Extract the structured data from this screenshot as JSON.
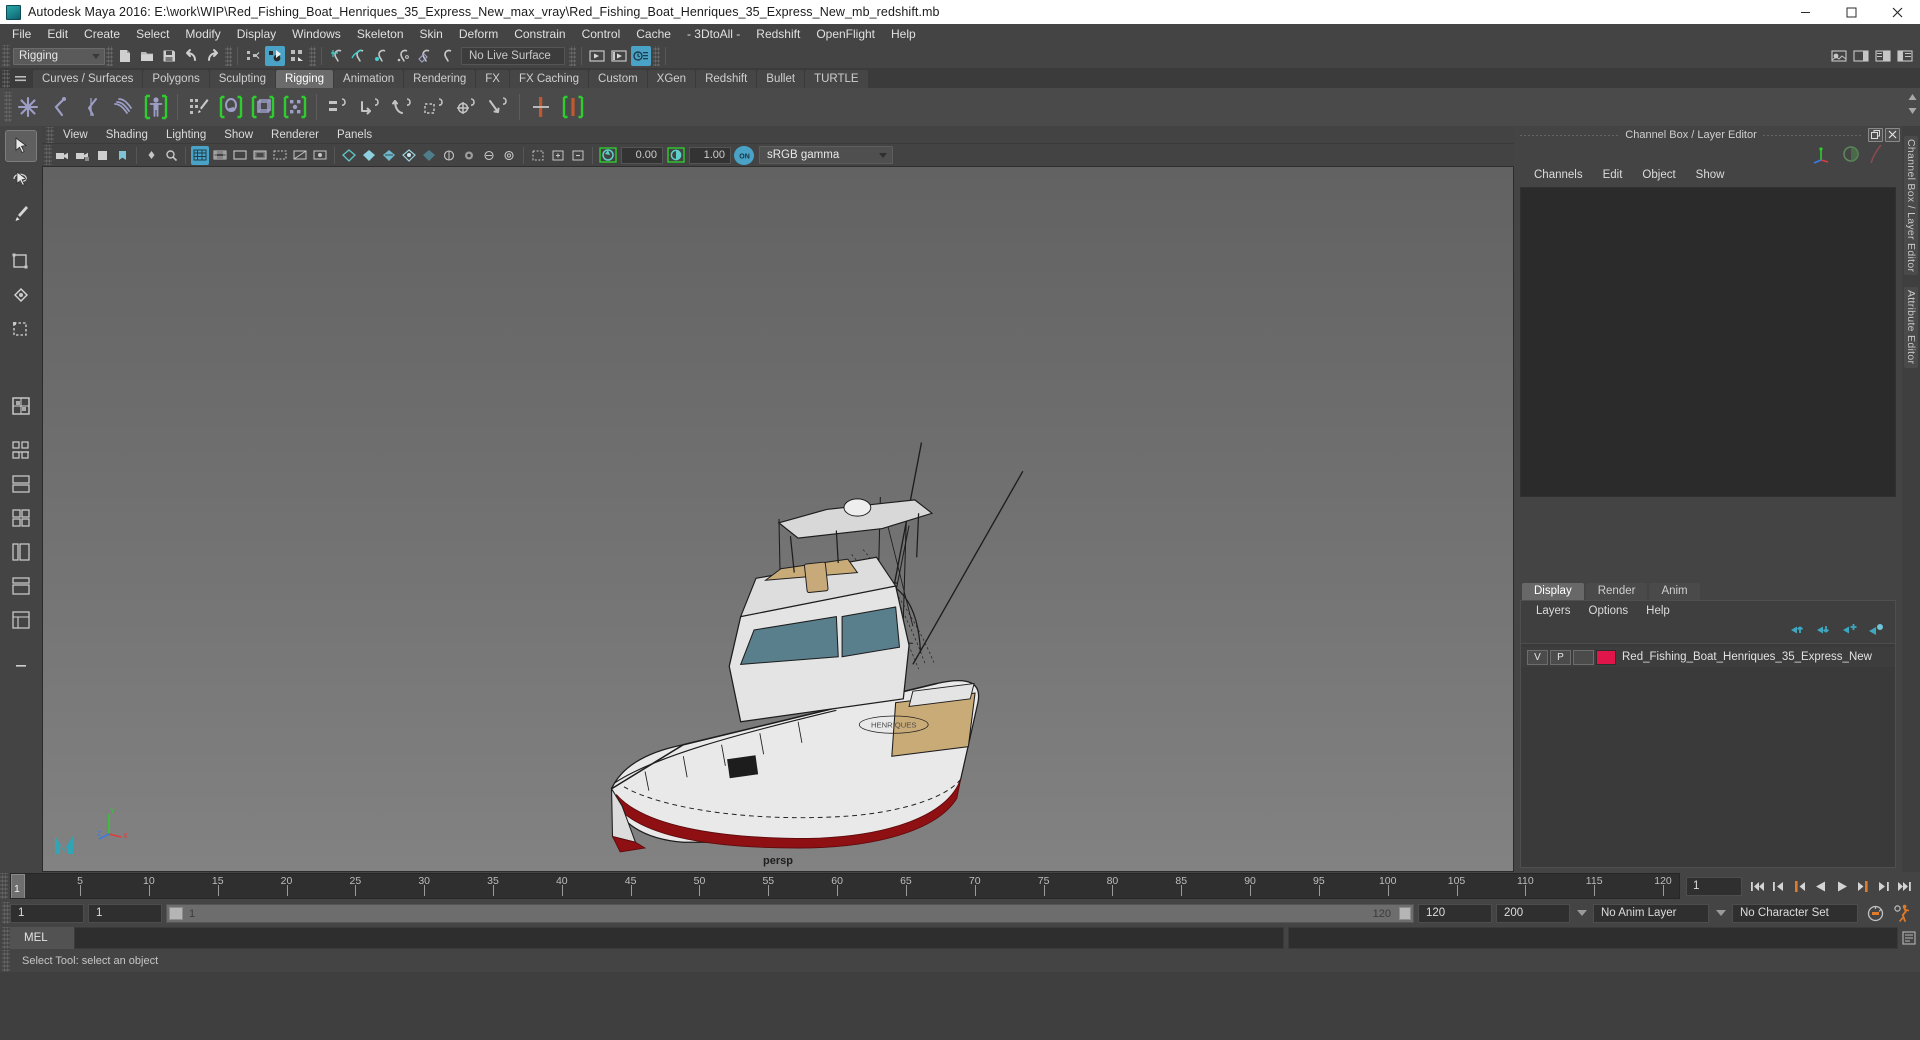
{
  "window": {
    "title": "Autodesk Maya 2016: E:\\work\\WIP\\Red_Fishing_Boat_Henriques_35_Express_New_max_vray\\Red_Fishing_Boat_Henriques_35_Express_New_mb_redshift.mb",
    "icon": "maya-app-icon",
    "minimize": "–",
    "maximize": "□",
    "close": "✕"
  },
  "menubar": {
    "items": [
      {
        "label": "File"
      },
      {
        "label": "Edit"
      },
      {
        "label": "Create"
      },
      {
        "label": "Select"
      },
      {
        "label": "Modify"
      },
      {
        "label": "Display"
      },
      {
        "label": "Windows"
      },
      {
        "label": "Skeleton"
      },
      {
        "label": "Skin"
      },
      {
        "label": "Deform"
      },
      {
        "label": "Constrain"
      },
      {
        "label": "Control"
      },
      {
        "label": "Cache"
      },
      {
        "label": "- 3DtoAll -"
      },
      {
        "label": "Redshift"
      },
      {
        "label": "OpenFlight"
      },
      {
        "label": "Help"
      }
    ]
  },
  "toolbar": {
    "menuset": "Rigging",
    "live_surface": "No Live Surface",
    "icons": [
      {
        "name": "new-scene-icon"
      },
      {
        "name": "open-scene-icon"
      },
      {
        "name": "save-scene-icon"
      },
      {
        "name": "undo-icon"
      },
      {
        "name": "redo-icon"
      },
      {
        "name": "select-hierarchy-icon"
      },
      {
        "name": "select-object-icon"
      },
      {
        "name": "select-component-icon"
      },
      {
        "name": "snap-grid-icon"
      },
      {
        "name": "snap-curve-icon"
      },
      {
        "name": "snap-point-icon"
      },
      {
        "name": "snap-projected-center-icon"
      },
      {
        "name": "snap-view-plane-icon"
      },
      {
        "name": "snap-magnet-icon"
      },
      {
        "name": "render-current-frame-icon"
      },
      {
        "name": "ipr-render-icon"
      },
      {
        "name": "render-settings-icon"
      },
      {
        "name": "toggle-sidebar-icon"
      },
      {
        "name": "channel-box-toggle-icon"
      },
      {
        "name": "attribute-editor-toggle-icon"
      },
      {
        "name": "tool-settings-toggle-icon"
      }
    ]
  },
  "shelf": {
    "tabs": [
      {
        "label": "Curves / Surfaces",
        "selected": false
      },
      {
        "label": "Polygons",
        "selected": false
      },
      {
        "label": "Sculpting",
        "selected": false
      },
      {
        "label": "Rigging",
        "selected": true
      },
      {
        "label": "Animation",
        "selected": false
      },
      {
        "label": "Rendering",
        "selected": false
      },
      {
        "label": "FX",
        "selected": false
      },
      {
        "label": "FX Caching",
        "selected": false
      },
      {
        "label": "Custom",
        "selected": false
      },
      {
        "label": "XGen",
        "selected": false
      },
      {
        "label": "Redshift",
        "selected": false
      },
      {
        "label": "Bullet",
        "selected": false
      },
      {
        "label": "TURTLE",
        "selected": false
      }
    ],
    "icons": [
      {
        "name": "create-joint-icon"
      },
      {
        "name": "create-ik-handle-icon"
      },
      {
        "name": "create-ik-spline-icon"
      },
      {
        "name": "insert-joint-icon"
      },
      {
        "name": "quick-rig-icon"
      },
      {
        "name": "paint-skin-weights-icon"
      },
      {
        "name": "bind-skin-icon"
      },
      {
        "name": "lattice-deformer-icon"
      },
      {
        "name": "cluster-deformer-icon"
      },
      {
        "name": "parent-constraint-icon"
      },
      {
        "name": "point-constraint-icon"
      },
      {
        "name": "orient-constraint-icon"
      },
      {
        "name": "scale-constraint-icon"
      },
      {
        "name": "aim-constraint-icon"
      },
      {
        "name": "pole-vector-constraint-icon"
      },
      {
        "name": "ik-fk-switch-icon"
      },
      {
        "name": "mirror-joint-icon"
      }
    ]
  },
  "tools": {
    "items": [
      {
        "name": "select-tool",
        "selected": true
      },
      {
        "name": "lasso-select-tool",
        "selected": false
      },
      {
        "name": "paint-select-tool",
        "selected": false
      },
      {
        "name": "move-tool",
        "selected": false
      },
      {
        "name": "rotate-tool",
        "selected": false
      },
      {
        "name": "scale-tool",
        "selected": false
      },
      {
        "name": "last-tool-used",
        "selected": false
      },
      {
        "name": "quick-layout-single",
        "selected": false
      },
      {
        "name": "quick-layout-two-panes-side",
        "selected": false
      },
      {
        "name": "quick-layout-two-panes-stacked",
        "selected": false
      },
      {
        "name": "quick-layout-four-panes",
        "selected": false
      },
      {
        "name": "quick-layout-outliner-persp",
        "selected": false
      },
      {
        "name": "quick-layout-hypershade",
        "selected": false
      },
      {
        "name": "quick-layout-persp-graph",
        "selected": false
      },
      {
        "name": "quick-layout-more",
        "selected": false
      }
    ]
  },
  "viewport": {
    "menus": [
      {
        "label": "View"
      },
      {
        "label": "Shading"
      },
      {
        "label": "Lighting"
      },
      {
        "label": "Show"
      },
      {
        "label": "Renderer"
      },
      {
        "label": "Panels"
      }
    ],
    "exposure": "0.00",
    "gamma_value": "1.00",
    "color_management": "sRGB gamma",
    "camera_label": "persp",
    "axis": {
      "x": "X",
      "y": "Y",
      "z": "Z"
    },
    "icons": [
      {
        "name": "select-camera-icon"
      },
      {
        "name": "lock-camera-icon"
      },
      {
        "name": "camera-attributes-icon"
      },
      {
        "name": "bookmarks-icon"
      },
      {
        "name": "image-plane-icon"
      },
      {
        "name": "two-d-pan-zoom-icon"
      },
      {
        "name": "grid-toggle-icon"
      },
      {
        "name": "film-gate-icon"
      },
      {
        "name": "resolution-gate-icon"
      },
      {
        "name": "gate-mask-icon"
      },
      {
        "name": "film-origin-icon"
      },
      {
        "name": "xray-toggle-icon"
      },
      {
        "name": "xray-joints-icon"
      },
      {
        "name": "wireframe-shading-icon"
      },
      {
        "name": "smooth-shade-all-icon"
      },
      {
        "name": "smooth-shade-textured-icon"
      },
      {
        "name": "use-all-lights-icon"
      },
      {
        "name": "shadows-icon"
      },
      {
        "name": "screen-space-ao-icon"
      },
      {
        "name": "motion-blur-icon"
      },
      {
        "name": "multisample-aa-icon"
      },
      {
        "name": "depth-of-field-icon"
      },
      {
        "name": "isolate-select-icon"
      },
      {
        "name": "exposure-icon"
      },
      {
        "name": "gamma-icon"
      },
      {
        "name": "color-management-toggle-icon"
      }
    ]
  },
  "channel_box": {
    "panel_title": "Channel Box / Layer Editor",
    "restore_glyph": "❐",
    "close_glyph": "✕",
    "menus": [
      {
        "label": "Channels"
      },
      {
        "label": "Edit"
      },
      {
        "label": "Object"
      },
      {
        "label": "Show"
      }
    ],
    "gizmos": [
      {
        "name": "axis-gizmo-icon"
      },
      {
        "name": "sphere-preview-icon"
      },
      {
        "name": "curve-icon"
      }
    ]
  },
  "layer_editor": {
    "tabs": [
      {
        "label": "Display",
        "selected": true
      },
      {
        "label": "Render",
        "selected": false
      },
      {
        "label": "Anim",
        "selected": false
      }
    ],
    "menus": [
      {
        "label": "Layers"
      },
      {
        "label": "Options"
      },
      {
        "label": "Help"
      }
    ],
    "buttons": [
      {
        "name": "move-layer-up-icon"
      },
      {
        "name": "move-layer-down-icon"
      },
      {
        "name": "create-new-layer-icon"
      },
      {
        "name": "create-layer-from-selected-icon"
      }
    ],
    "layers": [
      {
        "visibility": "V",
        "playback": "P",
        "state": "",
        "color": "#e0164b",
        "name": "Red_Fishing_Boat_Henriques_35_Express_New"
      }
    ]
  },
  "vertical_tabs": [
    {
      "label": "Channel Box / Layer Editor"
    },
    {
      "label": "Attribute Editor"
    }
  ],
  "timeline": {
    "start": 1,
    "end": 120,
    "current_frame": "1",
    "current_frame_field": "1",
    "tick_labels": [
      5,
      10,
      15,
      20,
      25,
      30,
      35,
      40,
      45,
      50,
      55,
      60,
      65,
      70,
      75,
      80,
      85,
      90,
      95,
      100,
      105,
      110,
      115,
      120
    ],
    "transport": [
      {
        "name": "go-to-start-button"
      },
      {
        "name": "step-back-frame-button"
      },
      {
        "name": "step-back-key-button"
      },
      {
        "name": "play-backwards-button"
      },
      {
        "name": "play-forwards-button"
      },
      {
        "name": "step-forward-key-button"
      },
      {
        "name": "step-forward-frame-button"
      },
      {
        "name": "go-to-end-button"
      }
    ]
  },
  "range_slider": {
    "anim_start": "1",
    "range_start": "1",
    "bar_left_label": "1",
    "bar_right_label": "120",
    "range_end": "120",
    "anim_end": "200",
    "anim_layer": "No Anim Layer",
    "character_set": "No Character Set",
    "auto_key_icon": "auto-keyframe-icon",
    "prefs_icon": "animation-preferences-icon"
  },
  "command_line": {
    "language": "MEL",
    "input_value": "",
    "output_value": ""
  },
  "status_bar": {
    "message": "Select Tool: select an object"
  },
  "colors": {
    "accent": "#4aa3c7",
    "shelf_green": "#2ecc2e",
    "layer_red": "#e0164b",
    "orange": "#e07b2a",
    "purple": "#9d9ec6",
    "title_bg": "#ffffff",
    "chrome_bg": "#444444",
    "viewport_bg": "#6f6f6f"
  }
}
